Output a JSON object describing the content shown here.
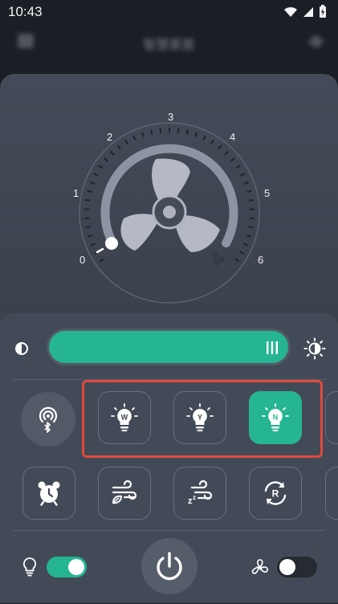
{
  "status": {
    "time": "10:43"
  },
  "header": {
    "title": "智慧家居"
  },
  "fan": {
    "speed_labels": [
      "0",
      "1",
      "2",
      "3",
      "4",
      "5",
      "6"
    ],
    "current_speed_level": 0
  },
  "brightness": {
    "level_percent": 100
  },
  "light_modes": [
    {
      "letter": "W",
      "active": false
    },
    {
      "letter": "Y",
      "active": false
    },
    {
      "letter": "N",
      "active": true
    }
  ],
  "functions": [
    "alarm-clock",
    "natural-wind",
    "sleep-wind",
    "reverse-rotation"
  ],
  "toggles": {
    "light_on": true,
    "fan_on": false
  },
  "colors": {
    "accent": "#25b592",
    "highlight": "#e04b3c",
    "panel": "#3e4450"
  }
}
